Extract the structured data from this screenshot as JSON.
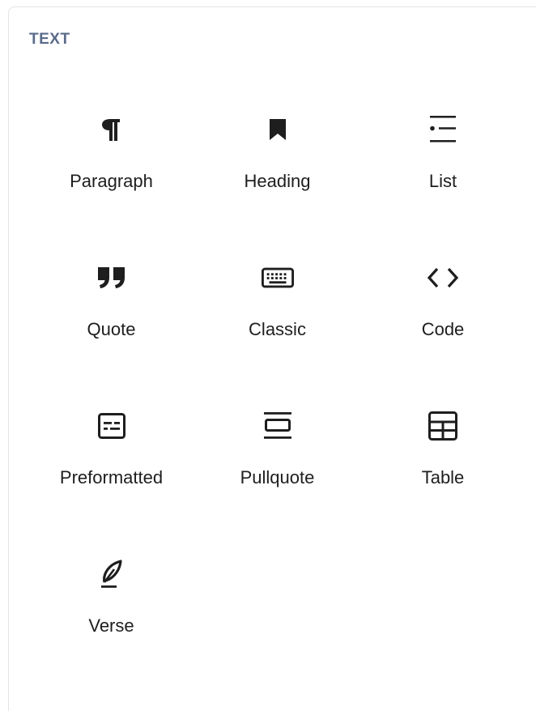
{
  "section": {
    "title": "TEXT"
  },
  "blocks": [
    {
      "label": "Paragraph",
      "icon": "paragraph-icon"
    },
    {
      "label": "Heading",
      "icon": "bookmark-icon"
    },
    {
      "label": "List",
      "icon": "list-icon"
    },
    {
      "label": "Quote",
      "icon": "quote-icon"
    },
    {
      "label": "Classic",
      "icon": "keyboard-icon"
    },
    {
      "label": "Code",
      "icon": "code-icon"
    },
    {
      "label": "Preformatted",
      "icon": "preformatted-icon"
    },
    {
      "label": "Pullquote",
      "icon": "pullquote-icon"
    },
    {
      "label": "Table",
      "icon": "table-icon"
    },
    {
      "label": "Verse",
      "icon": "feather-icon"
    }
  ],
  "colors": {
    "text": "#1e1e1e",
    "section_title": "#5b6b8a",
    "border": "#e4e4e4"
  }
}
